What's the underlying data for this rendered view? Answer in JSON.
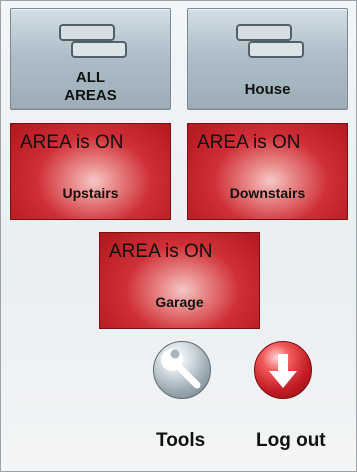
{
  "areas": {
    "all": {
      "label_line1": "ALL",
      "label_line2": "AREAS",
      "icon": "layers-icon"
    },
    "house": {
      "label": "House",
      "icon": "layers-icon"
    }
  },
  "zones": [
    {
      "status": "AREA is ON",
      "name": "Upstairs"
    },
    {
      "status": "AREA is ON",
      "name": "Downstairs"
    },
    {
      "status": "AREA is ON",
      "name": "Garage"
    }
  ],
  "actions": {
    "tools": {
      "label": "Tools",
      "icon": "wrench-icon"
    },
    "logout": {
      "label": "Log out",
      "icon": "down-arrow-icon"
    }
  },
  "colors": {
    "zone_on": "#c9262d",
    "area_button": "#aebfc9",
    "logout_button": "#c31c24",
    "background": "#eef2f4"
  }
}
